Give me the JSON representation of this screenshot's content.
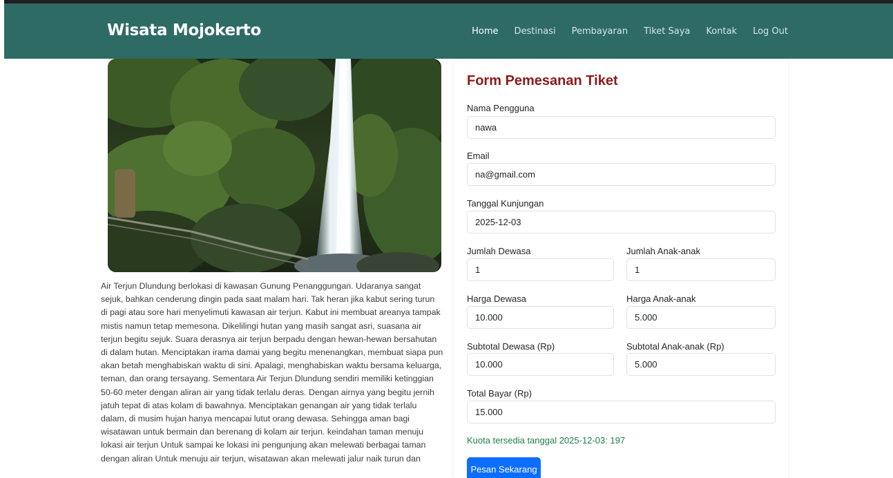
{
  "brand": "Wisata Mojokerto",
  "nav": {
    "items": [
      "Home",
      "Destinasi",
      "Pembayaran",
      "Tiket Saya",
      "Kontak",
      "Log Out"
    ],
    "active": "Home"
  },
  "article": {
    "text": "Air Terjun Dlundung berlokasi di kawasan Gunung Penanggungan. Udaranya sangat sejuk, bahkan cenderung dingin pada saat malam hari. Tak heran jika kabut sering turun di pagi atau sore hari menyelimuti kawasan air terjun. Kabut ini membuat areanya tampak mistis namun tetap memesona. Dikelilingi hutan yang masih sangat asri, suasana air terjun begitu sejuk. Suara derasnya air terjun berpadu dengan hewan-hewan bersahutan di dalam hutan. Menciptakan irama damai yang begitu menenangkan, membuat siapa pun akan betah menghabiskan waktu di sini. Apalagi, menghabiskan waktu bersama keluarga, teman, dan orang tersayang. Sementara Air Terjun Dlundung sendiri memiliki ketinggian 50-60 meter dengan aliran air yang tidak terlalu deras. Dengan airnya yang begitu jernih jatuh tepat di atas kolam di bawahnya. Menciptakan genangan air yang tidak terlalu dalam, di musim hujan hanya mencapai lutut orang dewasa. Sehingga aman bagi wisatawan untuk bermain dan berenang di kolam air terjun. keindahan taman menuju lokasi air terjun Untuk sampai ke lokasi ini pengunjung akan melewati berbagai taman dengan aliran Untuk menuju air terjun, wisatawan akan melewati jalur naik turun dan"
  },
  "form": {
    "title": "Form Pemesanan Tiket",
    "nama_label": "Nama Pengguna",
    "nama_value": "nawa",
    "email_label": "Email",
    "email_value": "na@gmail.com",
    "tanggal_label": "Tanggal Kunjungan",
    "tanggal_value": "2025-12-03",
    "jumlah_dewasa_label": "Jumlah Dewasa",
    "jumlah_dewasa_value": "1",
    "jumlah_anak_label": "Jumlah Anak-anak",
    "jumlah_anak_value": "1",
    "harga_dewasa_label": "Harga Dewasa",
    "harga_dewasa_value": "10.000",
    "harga_anak_label": "Harga Anak-anak",
    "harga_anak_value": "5.000",
    "subtotal_dewasa_label": "Subtotal Dewasa (Rp)",
    "subtotal_dewasa_value": "10.000",
    "subtotal_anak_label": "Subtotal Anak-anak (Rp)",
    "subtotal_anak_value": "5.000",
    "total_label": "Total Bayar (Rp)",
    "total_value": "15.000",
    "quota_text": "Kuota tersedia tanggal 2025-12-03: 197",
    "submit_label": "Pesan Sekarang"
  },
  "colors": {
    "navbar": "#2e6b65",
    "form_title": "#8b1a1a",
    "quota": "#1e7e4a",
    "button": "#0d6efd"
  }
}
